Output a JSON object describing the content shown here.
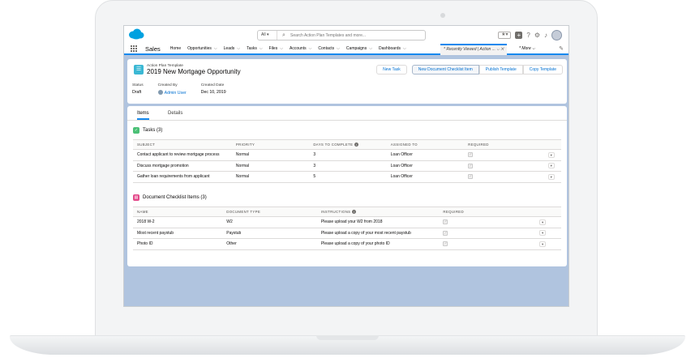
{
  "header": {
    "search_scope": "All",
    "search_placeholder": "Search Action Plan Templates and more..."
  },
  "icons": [
    "salesforce-cloud-icon",
    "search-icon",
    "star-icon",
    "plus-icon",
    "help-icon",
    "gear-icon",
    "bell-icon",
    "avatar",
    "waffle-icon",
    "edit-icon"
  ],
  "nav": {
    "app_name": "Sales",
    "items": [
      "Home",
      "Opportunities",
      "Leads",
      "Tasks",
      "Files",
      "Accounts",
      "Contacts",
      "Campaigns",
      "Dashboards"
    ],
    "active_tab": "* Recently Viewed | Action ...",
    "more": "* More"
  },
  "record": {
    "type": "Action Plan Template",
    "title": "2019 New Mortgage Opportunity",
    "buttons": [
      "New Task",
      "New Document Checklist Item",
      "Publish Template",
      "Copy Template"
    ],
    "fields": [
      {
        "label": "Status",
        "value": "Draft"
      },
      {
        "label": "Created By",
        "value": "Admin User"
      },
      {
        "label": "Created Date",
        "value": "Dec 10, 2019"
      }
    ]
  },
  "tabs": [
    "Items",
    "Details"
  ],
  "tasks": {
    "title": "Tasks (3)",
    "columns": [
      "SUBJECT",
      "PRIORITY",
      "DAYS TO COMPLETE",
      "ASSIGNED TO",
      "REQUIRED"
    ],
    "rows": [
      {
        "subject": "Contact applicant to review mortgage process",
        "priority": "Normal",
        "days": "3",
        "assigned": "Loan Officer"
      },
      {
        "subject": "Discuss mortgage promotion",
        "priority": "Normal",
        "days": "3",
        "assigned": "Loan Officer"
      },
      {
        "subject": "Gather loan requirements from applicant",
        "priority": "Normal",
        "days": "5",
        "assigned": "Loan Officer"
      }
    ]
  },
  "docs": {
    "title": "Document Checklist Items (3)",
    "columns": [
      "NAME",
      "DOCUMENT TYPE",
      "INSTRUCTIONS",
      "REQUIRED"
    ],
    "rows": [
      {
        "name": "2018 W-2",
        "type": "W2",
        "instructions": "Please upload your W2 from 2018"
      },
      {
        "name": "Most recent paystub",
        "type": "Paystub",
        "instructions": "Please upload a copy of your most recent paystub"
      },
      {
        "name": "Photo ID",
        "type": "Other",
        "instructions": "Please upload a copy of your photo ID"
      }
    ]
  },
  "colors": {
    "brand": "#1589ee",
    "link": "#0070d2",
    "background": "#b0c4df",
    "tasks_icon": "#4bc076",
    "docs_icon": "#e3498a"
  }
}
